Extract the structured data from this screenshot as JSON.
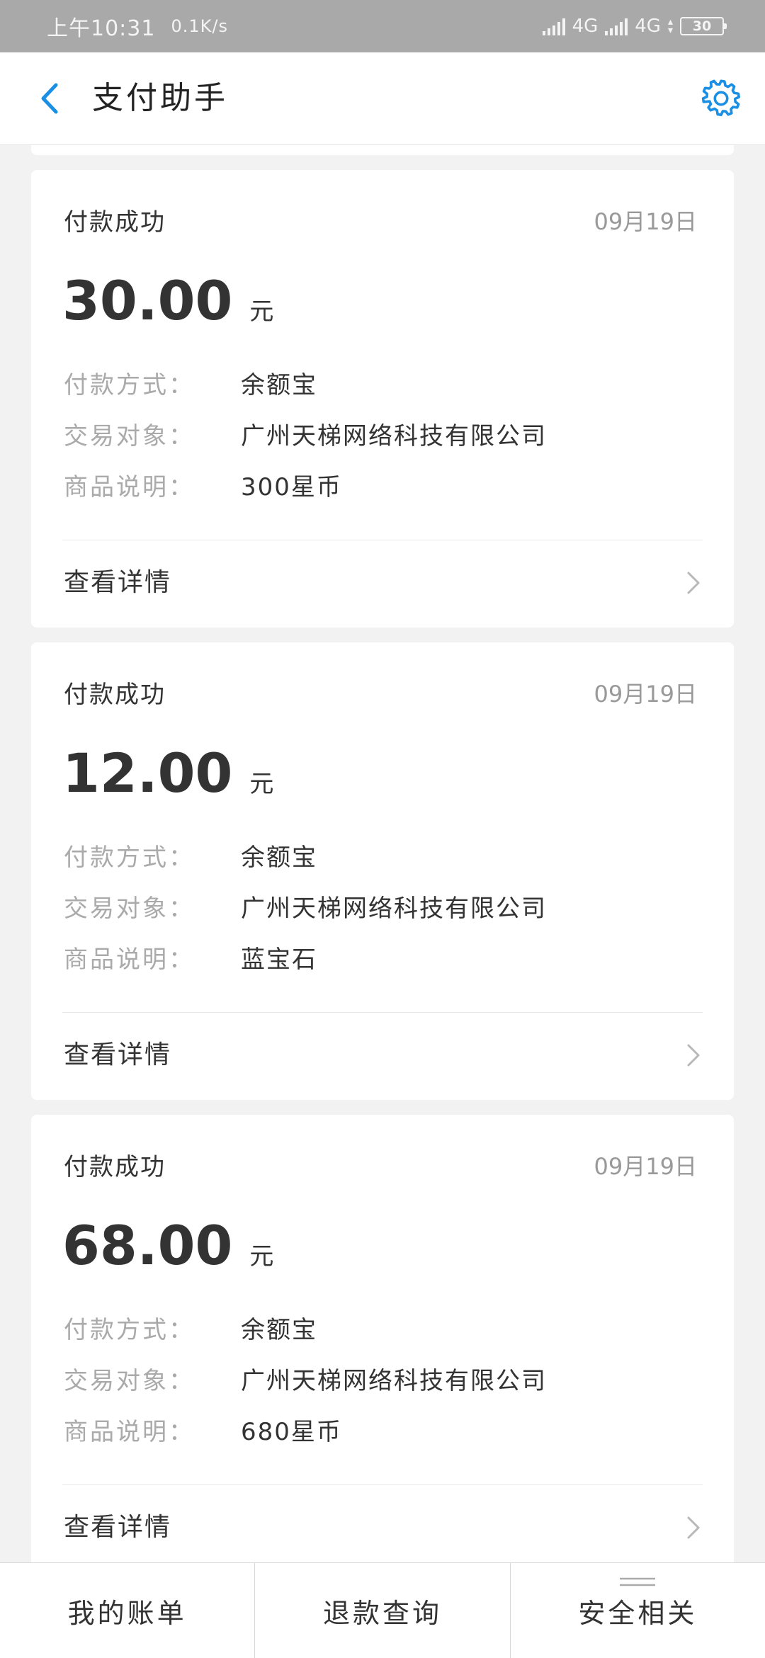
{
  "status_bar": {
    "time": "上午10:31",
    "speed": "0.1K/s",
    "network1": "4G",
    "network2": "4G",
    "battery": "30"
  },
  "header": {
    "title": "支付助手",
    "back_icon": "chevron-left-icon",
    "settings_icon": "gear-icon"
  },
  "labels": {
    "method": "付款方式：",
    "counterparty": "交易对象：",
    "product": "商品说明：",
    "detail": "查看详情",
    "currency": "元"
  },
  "colors": {
    "accent": "#1a8fe3",
    "muted": "#aaaaaa"
  },
  "cards": [
    {
      "status": "付款成功",
      "date": "09月19日",
      "amount": "30.00",
      "method": "余额宝",
      "counterparty": "广州天梯网络科技有限公司",
      "product": "300星币"
    },
    {
      "status": "付款成功",
      "date": "09月19日",
      "amount": "12.00",
      "method": "余额宝",
      "counterparty": "广州天梯网络科技有限公司",
      "product": "蓝宝石"
    },
    {
      "status": "付款成功",
      "date": "09月19日",
      "amount": "68.00",
      "method": "余额宝",
      "counterparty": "广州天梯网络科技有限公司",
      "product": "680星币"
    }
  ],
  "tabs": [
    {
      "label": "我的账单"
    },
    {
      "label": "退款查询"
    },
    {
      "label": "安全相关"
    }
  ]
}
